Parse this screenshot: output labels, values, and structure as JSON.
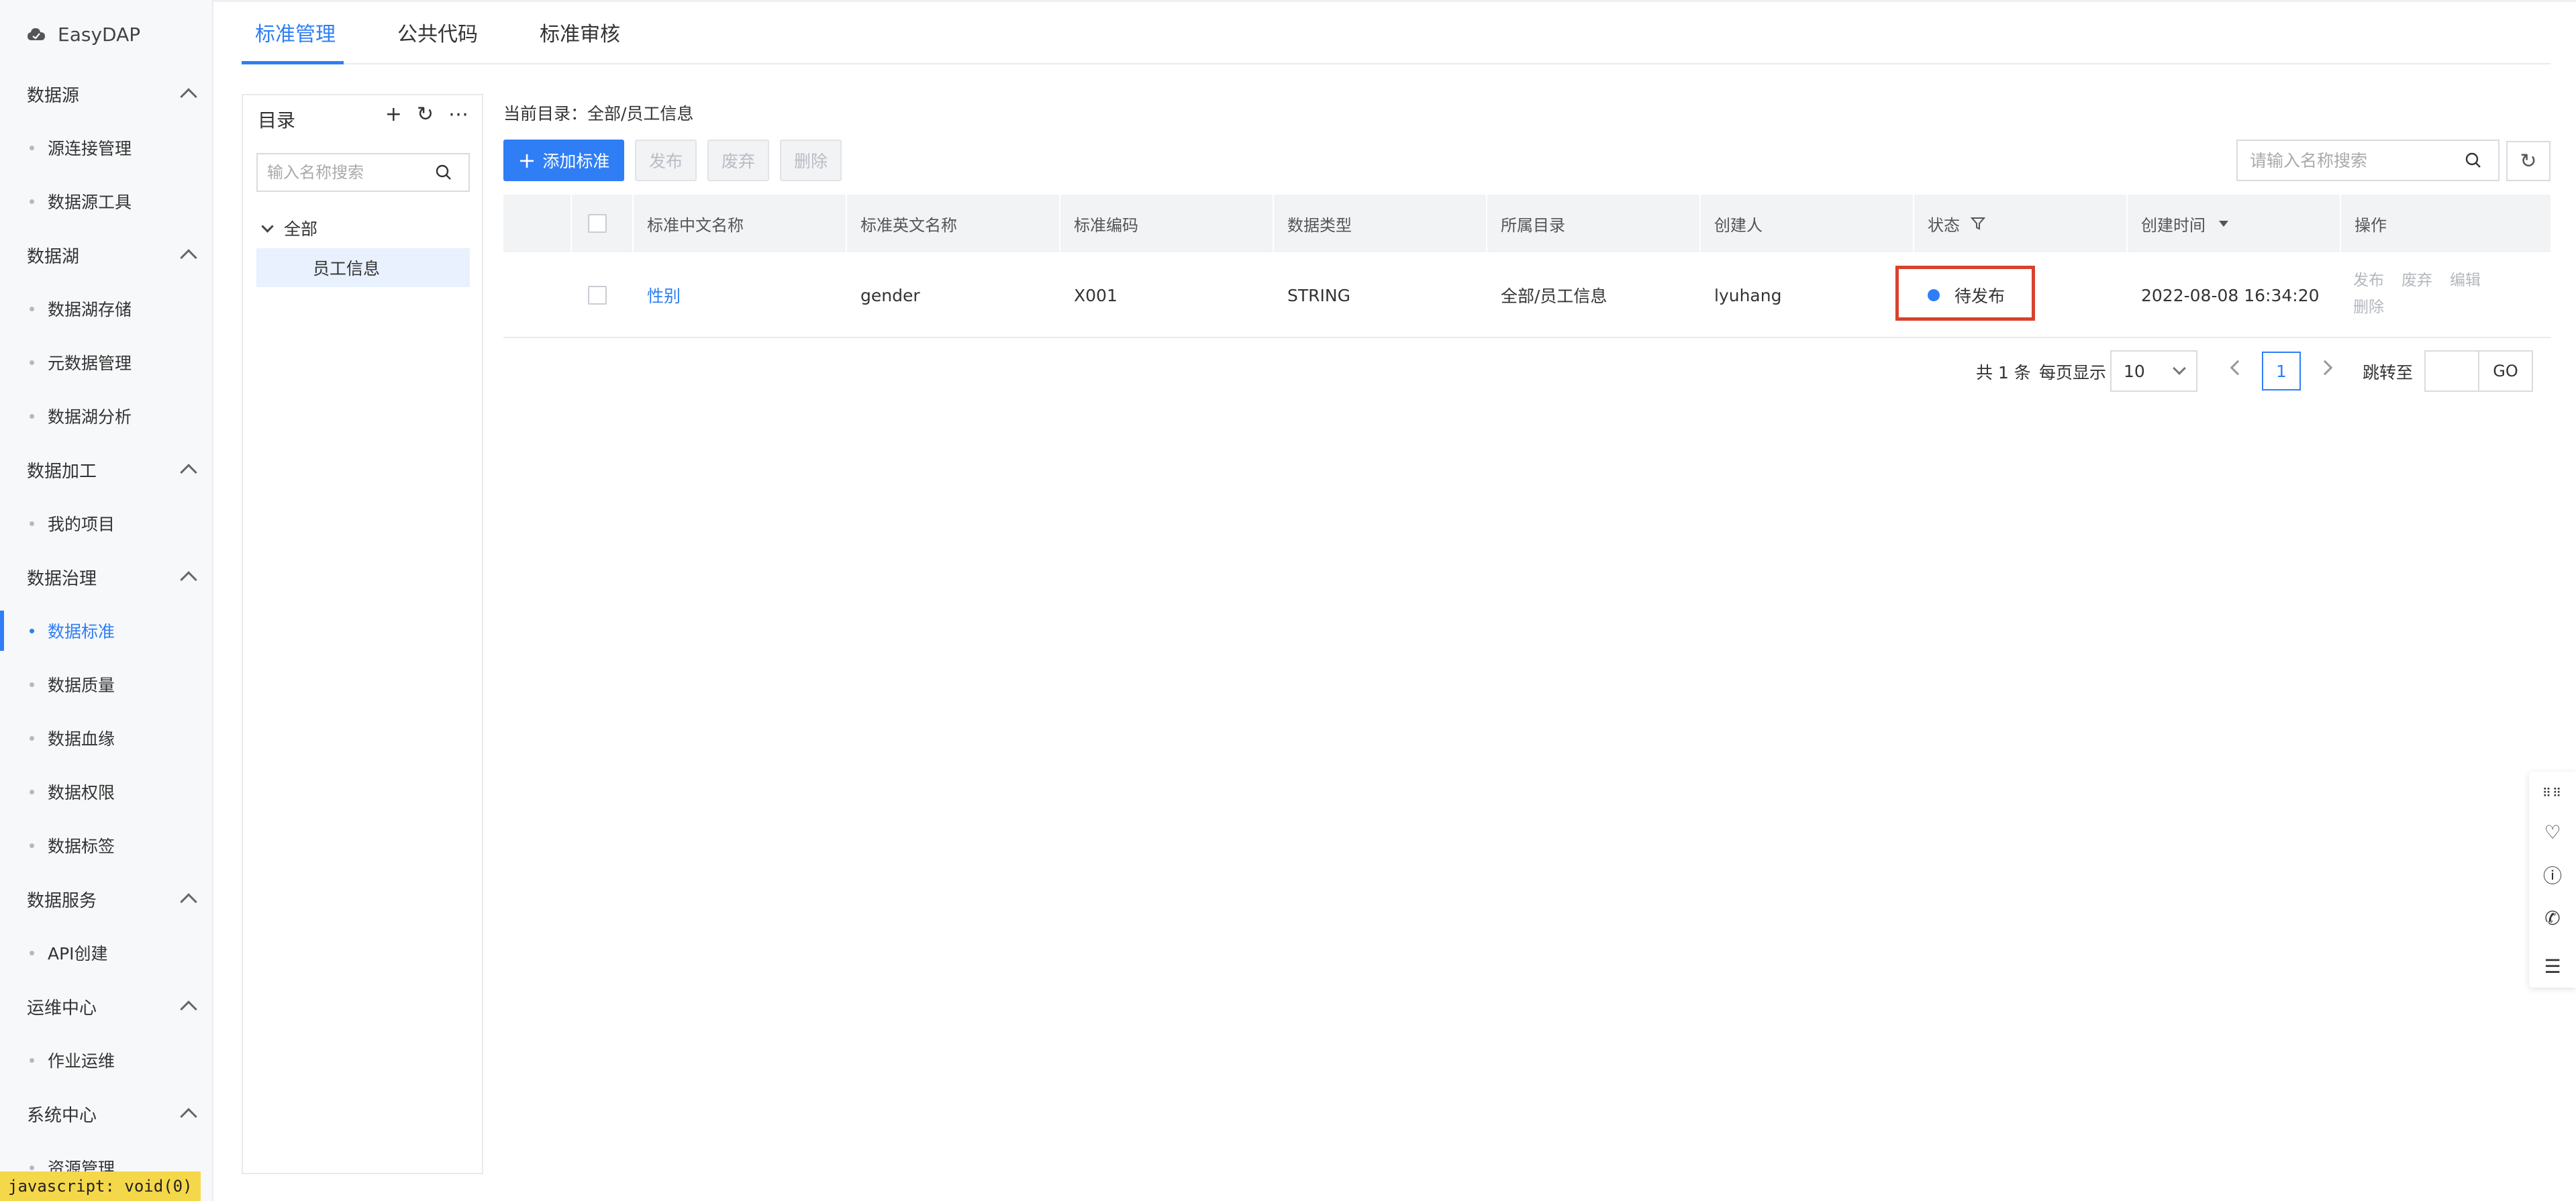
{
  "app": {
    "name": "EasyDAP"
  },
  "sidebar": {
    "groups": [
      {
        "label": "数据源",
        "items": [
          "源连接管理",
          "数据源工具"
        ]
      },
      {
        "label": "数据湖",
        "items": [
          "数据湖存储",
          "元数据管理",
          "数据湖分析"
        ]
      },
      {
        "label": "数据加工",
        "items": [
          "我的项目"
        ]
      },
      {
        "label": "数据治理",
        "items": [
          "数据标准",
          "数据质量",
          "数据血缘",
          "数据权限",
          "数据标签"
        ]
      },
      {
        "label": "数据服务",
        "items": [
          "API创建"
        ]
      },
      {
        "label": "运维中心",
        "items": [
          "作业运维"
        ]
      },
      {
        "label": "系统中心",
        "items": [
          "资源管理"
        ]
      }
    ],
    "active_item": "数据标准"
  },
  "status_tip": "javascript: void(0)",
  "tabs": [
    "标准管理",
    "公共代码",
    "标准审核"
  ],
  "tree": {
    "title": "目录",
    "search_placeholder": "输入名称搜索",
    "root": "全部",
    "child": "员工信息"
  },
  "main": {
    "breadcrumb": "当前目录：全部/员工信息",
    "buttons": {
      "add": "添加标准",
      "publish": "发布",
      "discard": "废弃",
      "delete": "删除"
    },
    "search_placeholder": "请输入名称搜索",
    "columns": [
      "标准中文名称",
      "标准英文名称",
      "标准编码",
      "数据类型",
      "所属目录",
      "创建人",
      "状态",
      "创建时间",
      "操作"
    ],
    "rows": [
      {
        "cn_name": "性别",
        "en_name": "gender",
        "code": "X001",
        "data_type": "STRING",
        "catalog": "全部/员工信息",
        "creator": "lyuhang",
        "status": "待发布",
        "created": "2022-08-08 16:34:20",
        "ops": [
          "发布",
          "废弃",
          "编辑",
          "删除"
        ]
      }
    ]
  },
  "pagination": {
    "total": "共 1 条",
    "per_page_label": "每页显示",
    "per_page": "10",
    "current": "1",
    "goto_label": "跳转至",
    "go": "GO"
  },
  "float_tools": [
    "grip-icon",
    "heart-icon",
    "help-icon",
    "phone-icon",
    "list-icon"
  ],
  "colors": {
    "accent": "#2f7ef5",
    "highlight": "#d9412e"
  }
}
